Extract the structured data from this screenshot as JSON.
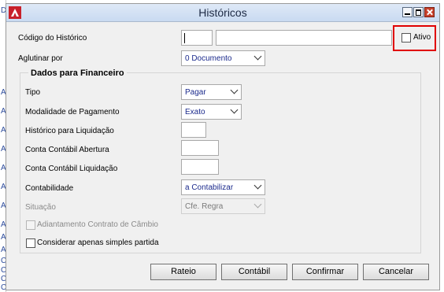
{
  "background_strip": [
    "D",
    "A",
    "A",
    "A",
    "A",
    "A",
    "A",
    "A",
    "A",
    "A",
    "A",
    "C",
    "C",
    "C",
    "C"
  ],
  "window": {
    "title": "Históricos",
    "minimize_icon": "minimize-icon",
    "maximize_icon": "maximize-icon",
    "close_icon": "close-icon"
  },
  "header": {
    "codigo_label": "Código do Histórico",
    "codigo_value": "",
    "descricao_value": "",
    "ativo_label": "Ativo",
    "ativo_checked": false,
    "aglutinar_label": "Aglutinar por",
    "aglutinar_value": "0 Documento"
  },
  "group": {
    "title": "Dados para Financeiro",
    "tipo_label": "Tipo",
    "tipo_value": "Pagar",
    "modalidade_label": "Modalidade de Pagamento",
    "modalidade_value": "Exato",
    "historico_liq_label": "Histórico para Liquidação",
    "conta_abertura_label": "Conta Contábil Abertura",
    "conta_liquidacao_label": "Conta Contábil Liquidação",
    "contabilidade_label": "Contabilidade",
    "contabilidade_value": "a Contabilizar",
    "situacao_label": "Situação",
    "situacao_value": "Cfe. Regra",
    "adiantamento_label": "Adiantamento Contrato de Câmbio",
    "considerar_label": "Considerar apenas simples partida"
  },
  "buttons": {
    "rateio": "Rateio",
    "contabil": "Contábil",
    "confirmar": "Confirmar",
    "cancelar": "Cancelar"
  },
  "colors": {
    "highlight": "#e00000",
    "close_button": "#c8412b",
    "select_text": "#1b2a8c"
  }
}
